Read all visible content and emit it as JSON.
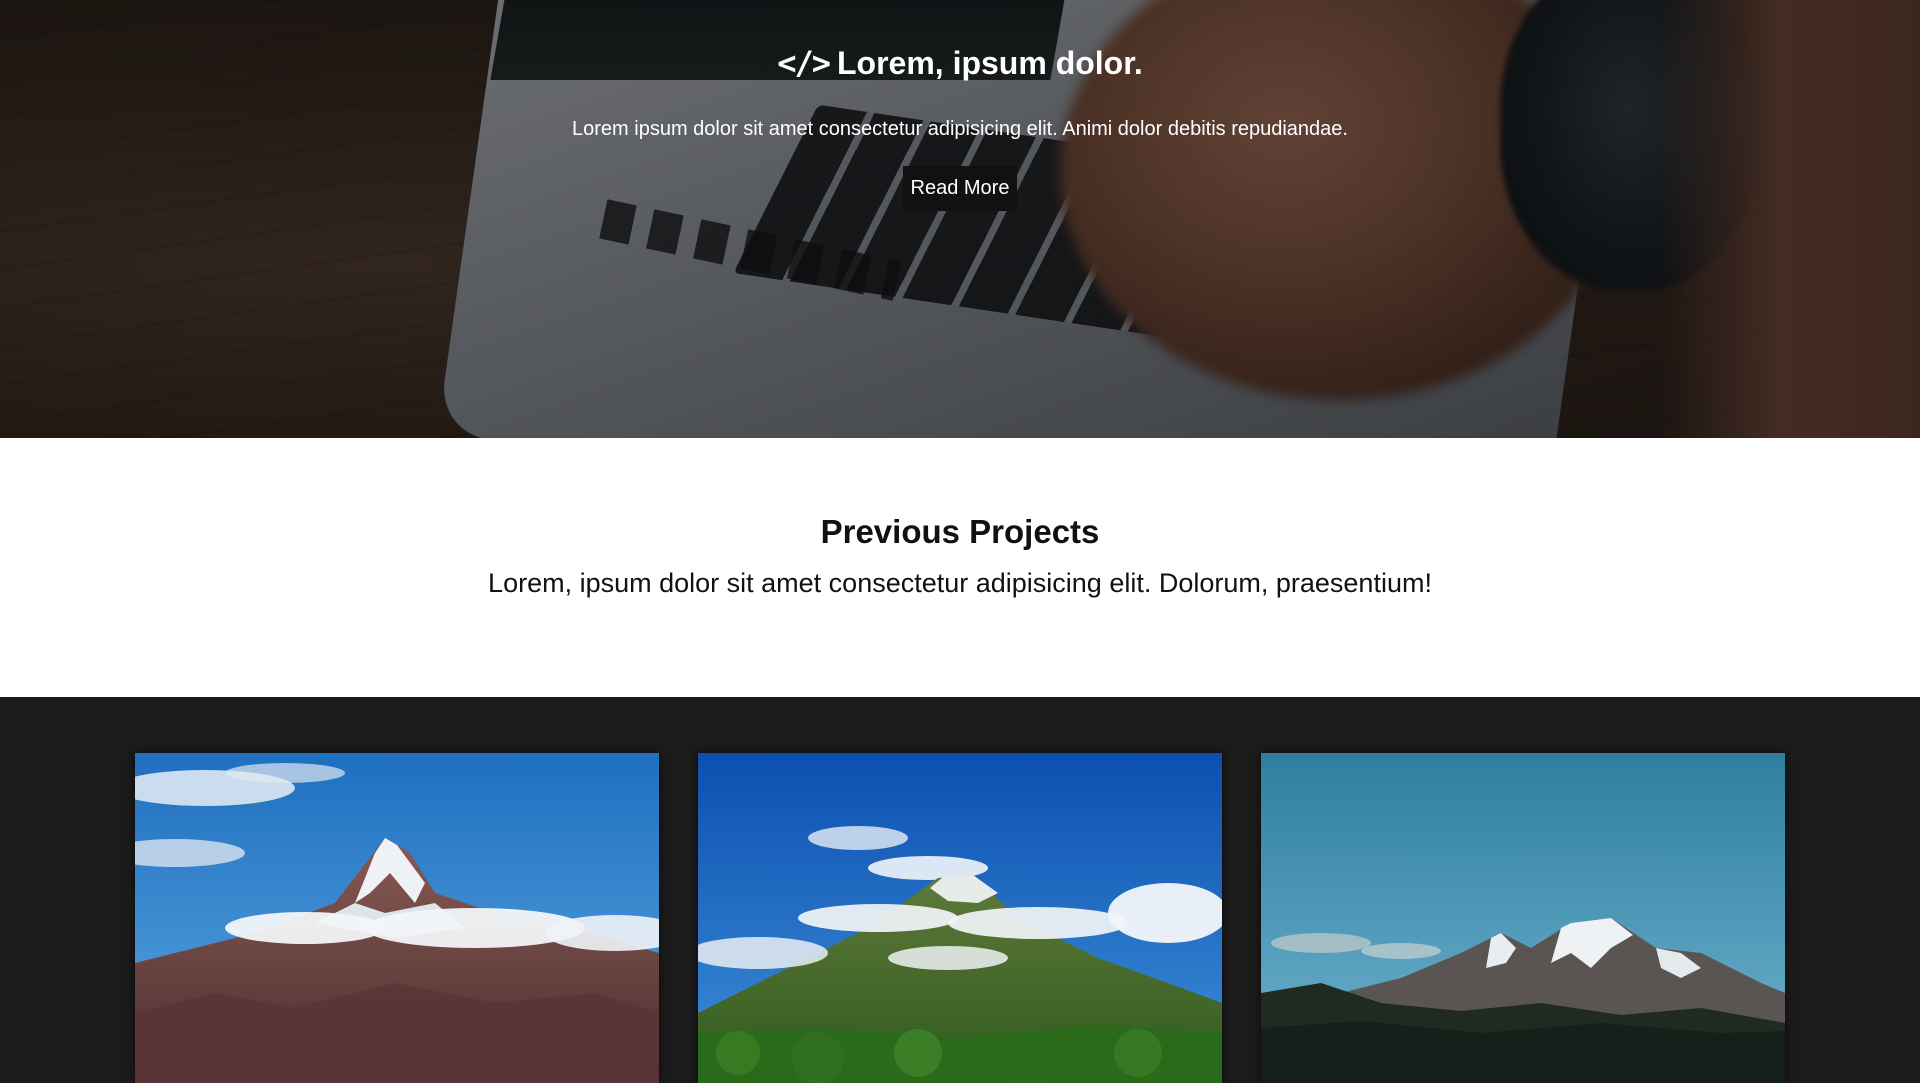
{
  "hero": {
    "icon": "code-icon",
    "icon_glyph": "</>",
    "title": "Lorem, ipsum dolor.",
    "text": "Lorem ipsum dolor sit amet consectetur adipisicing elit. Animi dolor debitis repudiandae.",
    "button_label": "Read More"
  },
  "projects": {
    "title": "Previous Projects",
    "text": "Lorem, ipsum dolor sit amet consectetur adipisicing elit. Dolorum, praesentium!"
  },
  "gallery": {
    "cards": [
      {
        "image": "snowy-peak-with-clouds"
      },
      {
        "image": "green-volcano-with-clouds"
      },
      {
        "image": "rocky-peaks-over-forest"
      }
    ]
  },
  "colors": {
    "button_bg": "#111111",
    "gallery_bg": "#1c1c1c",
    "text_dark": "#111111",
    "text_light": "#ffffff"
  }
}
